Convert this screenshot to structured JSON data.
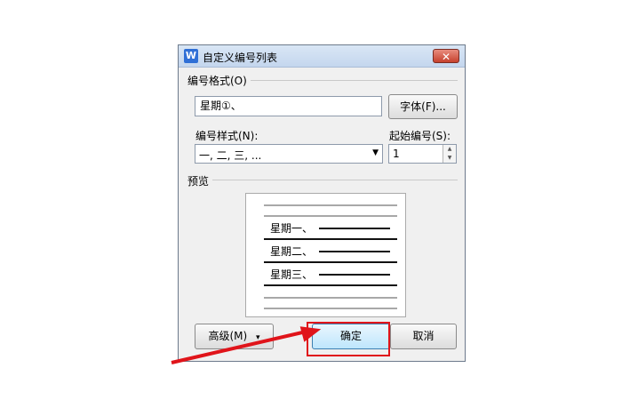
{
  "dialog": {
    "title": "自定义编号列表",
    "close_symbol": "✕",
    "app_icon_letter": "W"
  },
  "format_group": {
    "label": "编号格式(O)",
    "value": "星期①、",
    "font_button": "字体(F)..."
  },
  "style_field": {
    "label": "编号样式(N):",
    "selected": "一, 二, 三, ..."
  },
  "start_field": {
    "label": "起始编号(S):",
    "value": "1"
  },
  "preview_group": {
    "label": "预览",
    "items": [
      "星期一、",
      "星期二、",
      "星期三、"
    ]
  },
  "buttons": {
    "advanced": "高级(M)",
    "ok": "确定",
    "cancel": "取消"
  },
  "accent_color": "#e0141a"
}
